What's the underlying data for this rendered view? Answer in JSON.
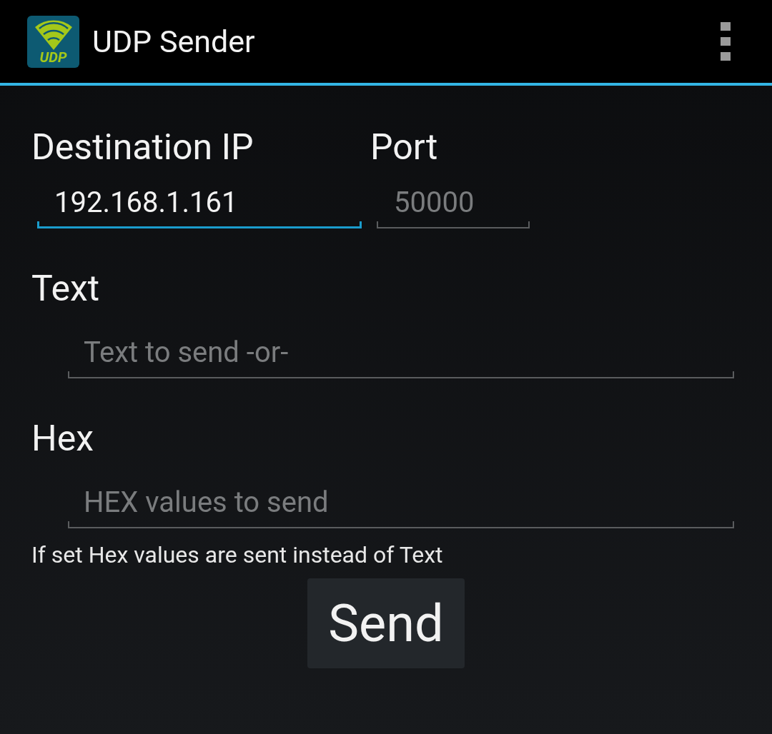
{
  "action_bar": {
    "logo_text": "UDP",
    "title": "UDP Sender"
  },
  "destination": {
    "label": "Destination IP",
    "field": {
      "value": "192.168.1.161",
      "focused": true
    }
  },
  "port": {
    "label": "Port",
    "field": {
      "placeholder": "50000",
      "focused": false
    }
  },
  "text": {
    "label": "Text",
    "field": {
      "placeholder": "Text to send -or-",
      "focused": false
    }
  },
  "hex": {
    "label": "Hex",
    "field": {
      "placeholder": "HEX values to send",
      "focused": false
    },
    "hint": "If set Hex values are sent instead of Text"
  },
  "send_button": "Send"
}
